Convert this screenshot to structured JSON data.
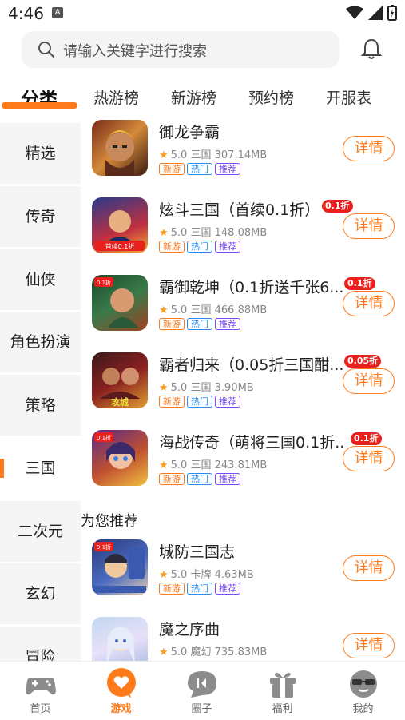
{
  "status_bar": {
    "time": "4:46",
    "notif_badge": "A"
  },
  "search": {
    "placeholder": "请输入关键字进行搜索"
  },
  "tabs": [
    {
      "label": "分类",
      "active": true
    },
    {
      "label": "热游榜"
    },
    {
      "label": "新游榜"
    },
    {
      "label": "预约榜"
    },
    {
      "label": "开服表"
    }
  ],
  "sidebar": {
    "items": [
      {
        "label": "精选"
      },
      {
        "label": "传奇"
      },
      {
        "label": "仙侠"
      },
      {
        "label": "角色扮演"
      },
      {
        "label": "策略"
      },
      {
        "label": "三国",
        "active": true
      },
      {
        "label": "二次元"
      },
      {
        "label": "玄幻"
      },
      {
        "label": "冒险"
      }
    ]
  },
  "games": [
    {
      "name": "御龙争霸",
      "rating": "5.0",
      "category": "三国",
      "size": "307.14MB",
      "badge": "",
      "icon_text": ""
    },
    {
      "name": "炫斗三国（首续0.1折）",
      "rating": "5.0",
      "category": "三国",
      "size": "148.08MB",
      "badge": "0.1折",
      "icon_text": "首续0.1折"
    },
    {
      "name": "霸御乾坤（0.1折送千张6...",
      "rating": "5.0",
      "category": "三国",
      "size": "466.88MB",
      "badge": "0.1折",
      "icon_text": "0.1折"
    },
    {
      "name": "霸者归来（0.05折三国酣...",
      "rating": "5.0",
      "category": "三国",
      "size": "3.90MB",
      "badge": "0.05折",
      "icon_text": "攻城"
    },
    {
      "name": "海战传奇（萌将三国0.1折...",
      "rating": "5.0",
      "category": "三国",
      "size": "243.81MB",
      "badge": "0.1折",
      "icon_text": "0.1折"
    }
  ],
  "tags": {
    "new": "新游",
    "hot": "热门",
    "rec": "推荐"
  },
  "detail_label": "详情",
  "recommend": {
    "title": "为您推荐",
    "games": [
      {
        "name": "城防三国志",
        "rating": "5.0",
        "category": "卡牌",
        "size": "4.63MB",
        "icon_text": "0.1折"
      },
      {
        "name": "魔之序曲",
        "rating": "5.0",
        "category": "魔幻",
        "size": "735.83MB",
        "icon_text": ""
      }
    ]
  },
  "bottom_nav": [
    {
      "label": "首页",
      "icon": "gamepad-icon"
    },
    {
      "label": "游戏",
      "icon": "heart-chat-icon",
      "active": true
    },
    {
      "label": "圈子",
      "icon": "chat-bubble-icon"
    },
    {
      "label": "福利",
      "icon": "gift-icon"
    },
    {
      "label": "我的",
      "icon": "profile-face-icon"
    }
  ],
  "colors": {
    "accent": "#ff7a1a",
    "badge_red": "#e8201e",
    "tag_blue": "#2a8cf0",
    "tag_purple": "#7a4cf5"
  }
}
